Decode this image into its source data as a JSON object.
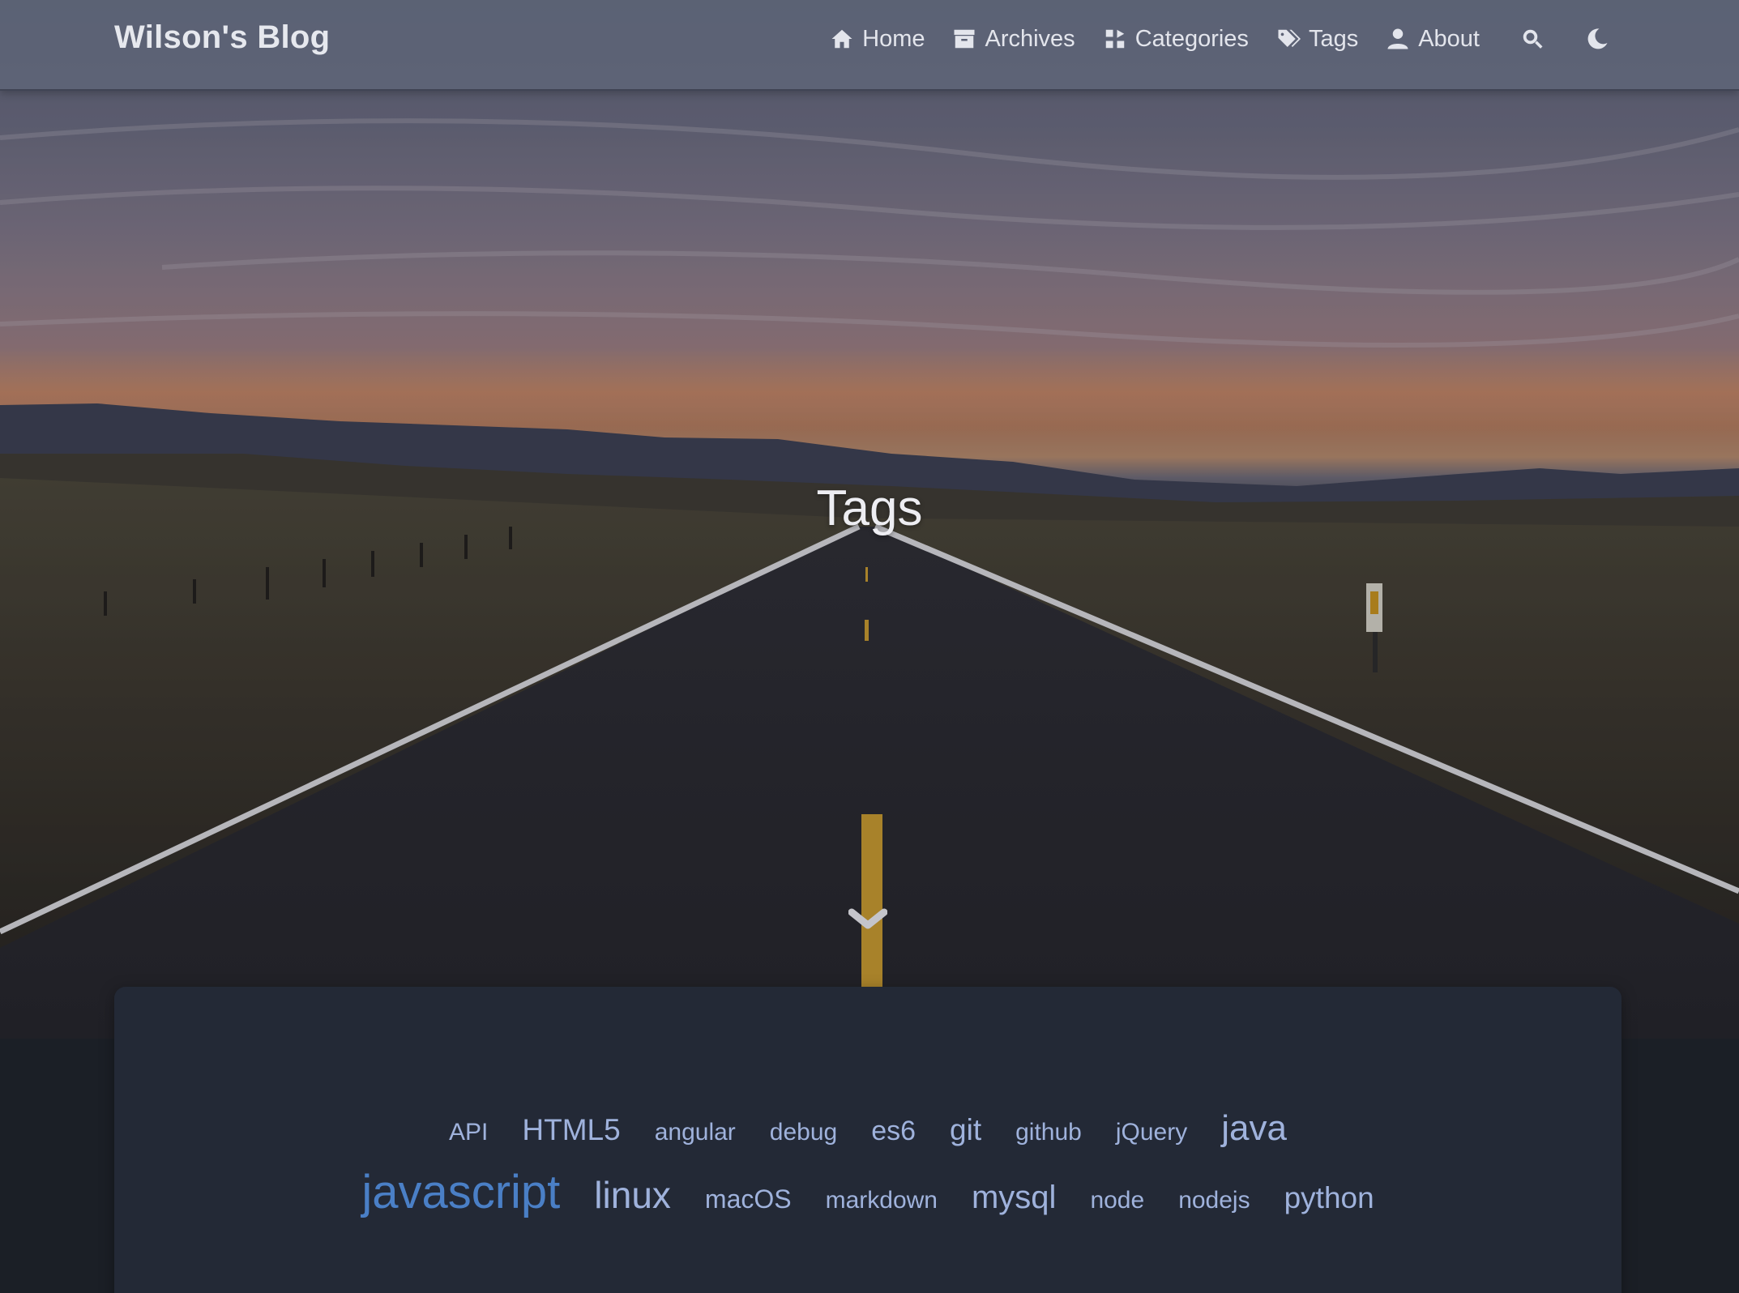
{
  "navbar": {
    "brand": "Wilson's Blog",
    "items": [
      {
        "label": "Home",
        "icon": "home-icon"
      },
      {
        "label": "Archives",
        "icon": "archive-icon"
      },
      {
        "label": "Categories",
        "icon": "categories-icon"
      },
      {
        "label": "Tags",
        "icon": "tags-icon"
      },
      {
        "label": "About",
        "icon": "user-icon"
      }
    ],
    "search_icon": "search-icon",
    "theme_icon": "moon-icon"
  },
  "hero": {
    "title": "Tags",
    "scroll_icon": "chevron-down-icon"
  },
  "tags": {
    "row1": [
      "API",
      "HTML5",
      "angular",
      "debug",
      "es6",
      "git",
      "github",
      "jQuery",
      "java"
    ],
    "row2": [
      "javascript",
      "linux",
      "macOS",
      "markdown",
      "mysql",
      "node",
      "nodejs",
      "python"
    ]
  },
  "colors": {
    "tag_default": "#9fb2dc",
    "tag_highlight": "#4a7fc6",
    "card_background": "#232936",
    "page_background": "#1b1f26"
  }
}
